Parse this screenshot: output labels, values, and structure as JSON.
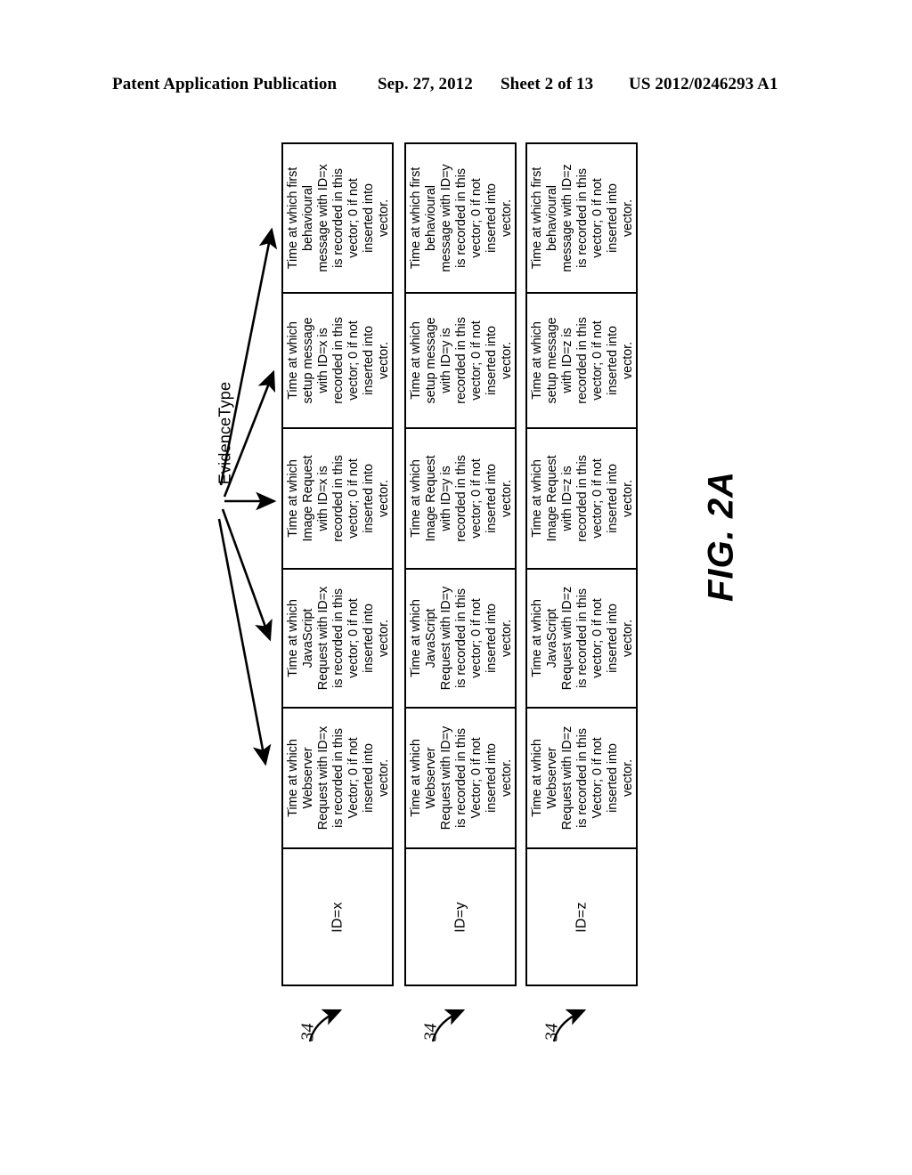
{
  "header": {
    "publication": "Patent Application Publication",
    "date": "Sep. 27, 2012",
    "sheet": "Sheet 2 of 13",
    "publication_number": "US 2012/0246293 A1"
  },
  "figure": {
    "caption": "FIG. 2A",
    "axis_label": "EvidenceType",
    "reference_numeral": "34",
    "arrow_count": 5
  },
  "tables": [
    {
      "id_label": "ID=x",
      "cells": [
        "Time at which first behavioural message with ID=x is recorded in this vector; 0 if not inserted into vector.",
        "Time at which setup message with ID=x is recorded in this vector; 0 if not inserted into vector.",
        "Time at which Image Request with ID=x is recorded in this vector; 0 if not inserted into vector.",
        "Time at which JavaScript Request with ID=x is recorded in this vector; 0 if not inserted into vector.",
        "Time at which Webserver Request with ID=x is recorded in this Vector; 0 if not inserted into vector."
      ]
    },
    {
      "id_label": "ID=y",
      "cells": [
        "Time at which first behavioural message with ID=y is recorded in this vector; 0 if not inserted into vector.",
        "Time at which setup message with ID=y is recorded in this vector; 0 if not inserted into vector.",
        "Time at which Image Request with ID=y is recorded in this vector; 0 if not inserted into vector.",
        "Time at which JavaScript Request with ID=y is recorded in this vector; 0 if not inserted into vector.",
        "Time at which Webserver Request with ID=y is recorded in this Vector; 0 if not inserted into vector."
      ]
    },
    {
      "id_label": "ID=z",
      "cells": [
        "Time at which first behavioural message with ID=z is recorded in this vector; 0 if not inserted into vector.",
        "Time at which setup message with ID=z is recorded in this vector; 0 if not inserted into vector.",
        "Time at which Image Request with ID=z is recorded in this vector; 0 if not inserted into vector.",
        "Time at which JavaScript Request with ID=z is recorded in this vector; 0 if not inserted into vector.",
        "Time at which Webserver Request with ID=z is recorded in this Vector; 0 if not inserted into vector."
      ]
    }
  ]
}
